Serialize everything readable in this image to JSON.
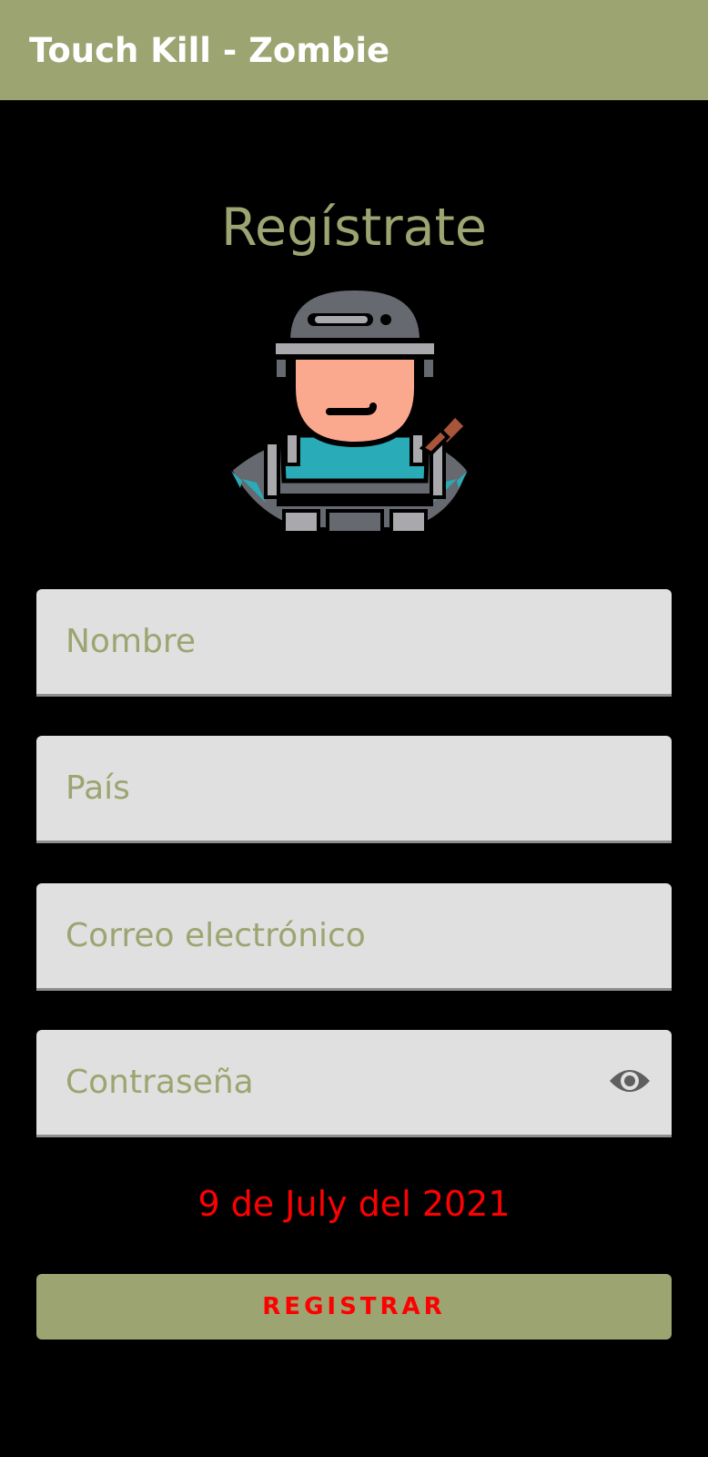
{
  "app_bar": {
    "title": "Touch Kill - Zombie",
    "color": "#9ca571"
  },
  "form": {
    "heading": "Regístrate",
    "avatar_icon": "soldier-avatar-icon",
    "fields": {
      "name": {
        "placeholder": "Nombre",
        "value": ""
      },
      "country": {
        "placeholder": "País",
        "value": ""
      },
      "email": {
        "placeholder": "Correo electrónico",
        "value": ""
      },
      "password": {
        "placeholder": "Contraseña",
        "value": "",
        "toggle_icon": "eye-icon"
      }
    },
    "date": "9 de July del 2021",
    "submit_label": "REGISTRAR"
  },
  "colors": {
    "accent": "#9ca571",
    "background": "#000000",
    "field_background": "#e0e0e0",
    "date_text": "#ff0000",
    "button_text": "#ff0000"
  }
}
